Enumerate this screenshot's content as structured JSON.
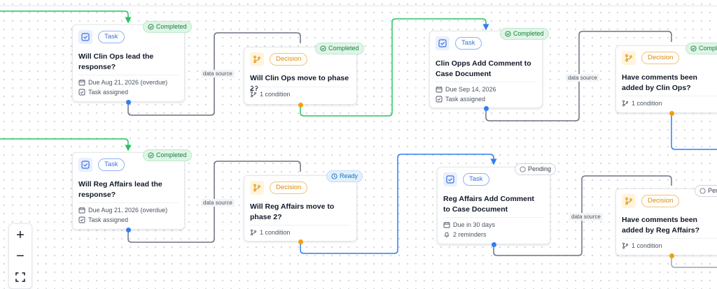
{
  "colors": {
    "completed": "#22c55e",
    "ready": "#2f7df6",
    "pending": "#374151",
    "task_accent": "#3b6fe0",
    "decision_accent": "#f59e0b"
  },
  "edge_label": "data source",
  "nodes": {
    "n1": {
      "type_label": "Task",
      "icon": "checkbox-icon",
      "status": "Completed",
      "title": "Will Clin Ops lead the response?",
      "meta1": "Due Aug 21, 2026 (overdue)",
      "meta2": "Task assigned"
    },
    "n2": {
      "type_label": "Decision",
      "icon": "branch-icon",
      "status": "Completed",
      "title": "Will Clin Ops move to phase 2?",
      "meta1": "1 condition"
    },
    "n3": {
      "type_label": "Task",
      "icon": "checkbox-icon",
      "status": "Completed",
      "title": "Clin Opps Add Comment to Case Document",
      "meta1": "Due Sep 14, 2026",
      "meta2": "Task assigned"
    },
    "n4": {
      "type_label": "Decision",
      "icon": "branch-icon",
      "status": "Comple",
      "title": "Have comments been added by Clin Ops?",
      "meta1": "1 condition"
    },
    "n5": {
      "type_label": "Task",
      "icon": "checkbox-icon",
      "status": "Completed",
      "title": "Will Reg Affairs lead the response?",
      "meta1": "Due Aug 21, 2026 (overdue)",
      "meta2": "Task assigned"
    },
    "n6": {
      "type_label": "Decision",
      "icon": "branch-icon",
      "status": "Ready",
      "title": "Will Reg Affairs move to phase 2?",
      "meta1": "1 condition"
    },
    "n7": {
      "type_label": "Task",
      "icon": "checkbox-icon",
      "status": "Pending",
      "title": "Reg Affairs Add Comment to Case Document",
      "meta1": "Due in 30 days",
      "meta2": "2 reminders"
    },
    "n8": {
      "type_label": "Decision",
      "icon": "branch-icon",
      "status": "Pen",
      "title": "Have comments been added by Reg Affairs?",
      "meta1": "1 condition"
    }
  },
  "controls": {
    "zoom_in": "+",
    "zoom_out": "−",
    "fit": "fit-view-icon"
  }
}
